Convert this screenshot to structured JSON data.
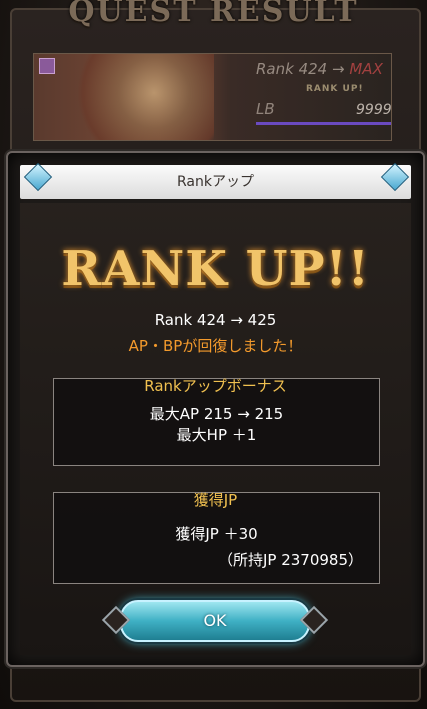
{
  "header": {
    "title": "QUEST RESULT"
  },
  "banner": {
    "rank_label": "Rank 424",
    "rank_arrow": "→",
    "rank_max": "MAX",
    "rank_up_text": "RANK UP!",
    "lb_label": "LB",
    "lb_value": "99999"
  },
  "modal": {
    "title": "Rankアップ",
    "headline": "RANK UP!!",
    "rank_change": "Rank 424 → 425",
    "recover_text": "AP・BPが回復しました！",
    "bonus": {
      "title": "Rankアップボーナス",
      "lines": [
        "最大AP 215 → 215",
        "最大HP ＋1"
      ]
    },
    "jp": {
      "title": "獲得JP",
      "gain": "獲得JP ＋30",
      "total": "（所持JP 2370985）"
    },
    "ok_label": "OK"
  },
  "colors": {
    "accent_orange": "#f39a2c",
    "accent_gold": "#f0c050",
    "ok_button": "#3fb0c4"
  }
}
